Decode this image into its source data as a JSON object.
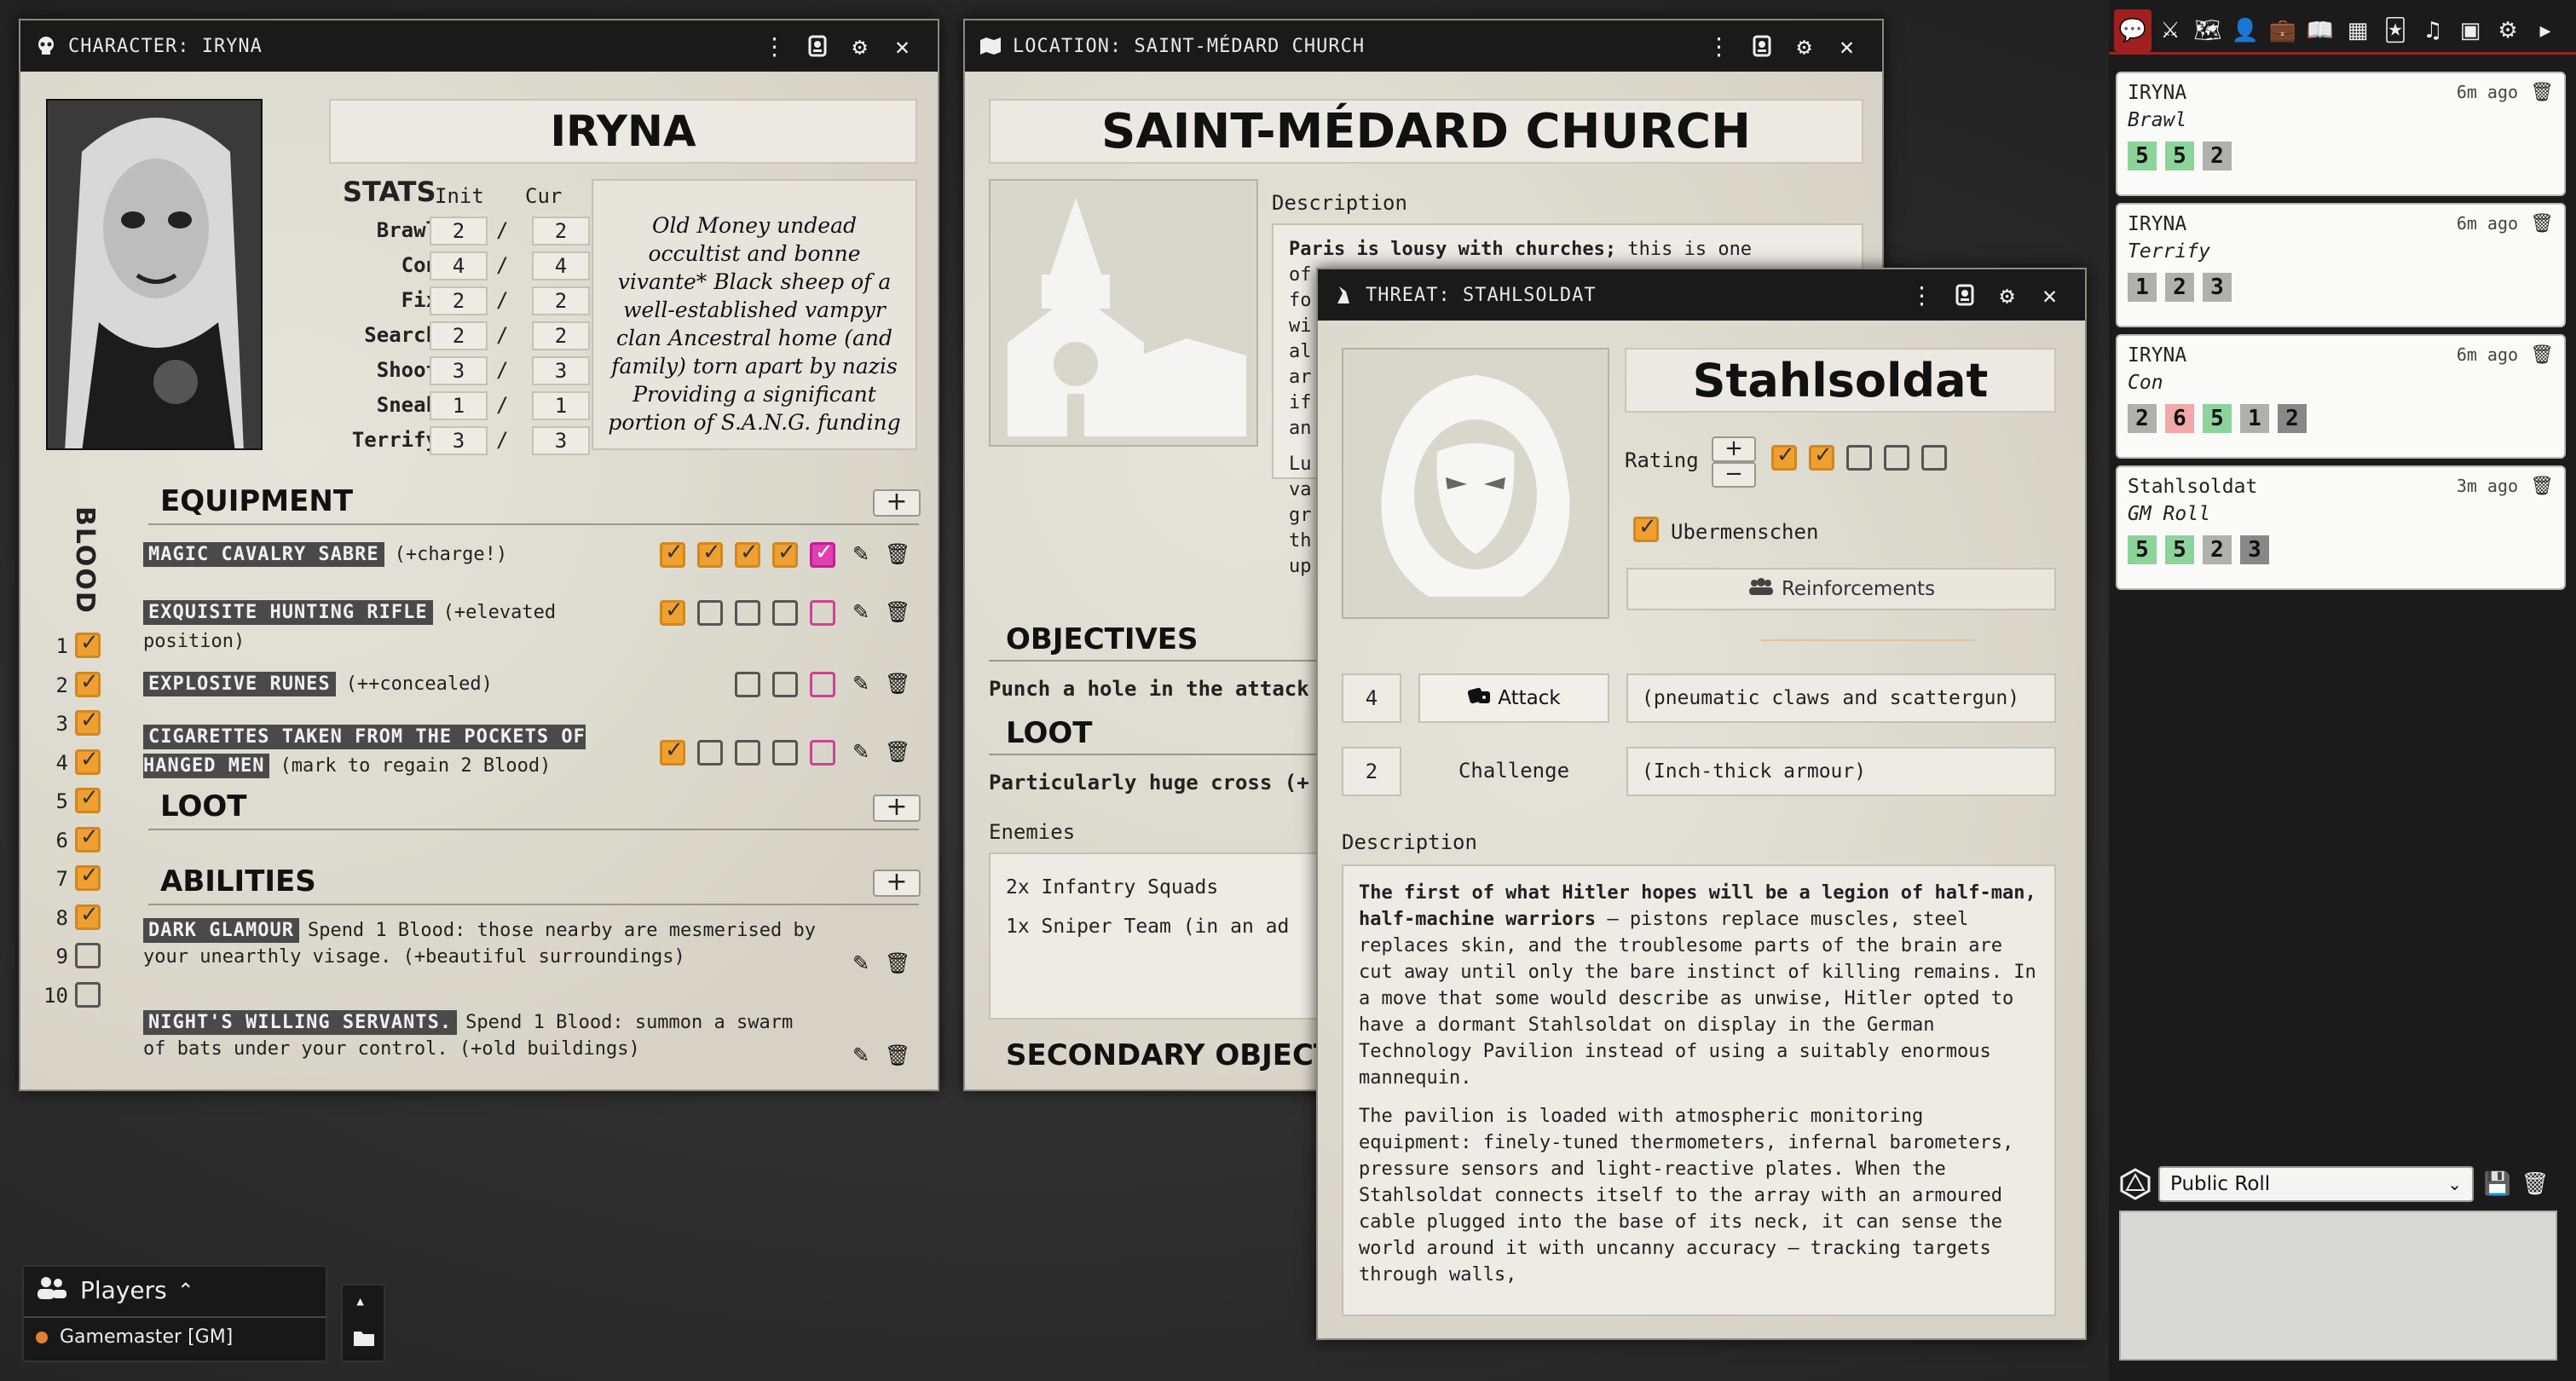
{
  "character": {
    "header": "CHARACTER: IRYNA",
    "name": "IRYNA",
    "stats_label": "STATS",
    "init_label": "Init",
    "cur_label": "Cur",
    "stats": [
      {
        "name": "Brawl",
        "init": "2",
        "cur": "2"
      },
      {
        "name": "Con",
        "init": "4",
        "cur": "4"
      },
      {
        "name": "Fix",
        "init": "2",
        "cur": "2"
      },
      {
        "name": "Search",
        "init": "2",
        "cur": "2"
      },
      {
        "name": "Shoot",
        "init": "3",
        "cur": "3"
      },
      {
        "name": "Sneak",
        "init": "1",
        "cur": "1"
      },
      {
        "name": "Terrify",
        "init": "3",
        "cur": "3"
      }
    ],
    "slash": "/",
    "bio": "Old Money undead occultist and bonne vivante* Black sheep of a well-established vampyr clan Ancestral home (and family) torn apart by nazis Providing a significant portion of S.A.N.G. funding",
    "blood_label": "BLOOD",
    "blood": [
      "1",
      "2",
      "3",
      "4",
      "5",
      "6",
      "7",
      "8",
      "9",
      "10"
    ],
    "blood_checked": 8,
    "equipment_label": "EQUIPMENT",
    "equipment": [
      {
        "name": "MAGIC CAVALRY SABRE",
        "note": "(+charge!)"
      },
      {
        "name": "EXQUISITE HUNTING RIFLE",
        "note": "(+elevated position)"
      },
      {
        "name": "EXPLOSIVE RUNES",
        "note": "(++concealed)"
      },
      {
        "name": "CIGARETTES TAKEN FROM THE POCKETS OF HANGED MEN",
        "note": "(mark to regain 2 Blood)"
      }
    ],
    "loot_label": "LOOT",
    "abilities_label": "ABILITIES",
    "abilities": [
      {
        "name": "DARK GLAMOUR",
        "text": "Spend 1 Blood: those nearby are mesmerised by your unearthly visage. (+beautiful surroundings)"
      },
      {
        "name": "NIGHT'S WILLING SERVANTS.",
        "text": "Spend 1 Blood: summon a swarm of bats under your control. (+old buildings)"
      }
    ]
  },
  "location": {
    "header": "LOCATION: SAINT-MÉDARD CHURCH",
    "name": "SAINT-MÉDARD CHURCH",
    "description_label": "Description",
    "desc_bold": "Paris is lousy with churches;",
    "desc_rest": "this is one",
    "desc_frag": [
      "of",
      "fo",
      "wi",
      "al",
      "ar",
      "if",
      "an"
    ],
    "desc_frag2": [
      "Lu",
      "va",
      "gr",
      "th",
      "up"
    ],
    "objectives_label": "OBJECTIVES",
    "objective": "Punch a hole in the attack",
    "loot_label": "LOOT",
    "loot": "Particularly huge cross (+",
    "enemies_label": "Enemies",
    "enemies": [
      "2x Infantry Squads",
      "1x Sniper Team (in an ad"
    ],
    "secondary_label": "SECONDARY OBJECT"
  },
  "threat": {
    "header": "THREAT: STAHLSOLDAT",
    "name": "Stahlsoldat",
    "rating_label": "Rating",
    "rating_plus": "+",
    "rating_minus": "−",
    "tag": "Ubermenschen",
    "reinforcements": "Reinforcements",
    "attack_value": "4",
    "attack_label": "Attack",
    "attack_desc": "(pneumatic claws and scattergun)",
    "challenge_value": "2",
    "challenge_label": "Challenge",
    "challenge_desc": "(Inch-thick armour)",
    "description_label": "Description",
    "desc_bold": "The first of what Hitler hopes will be a legion of half-man, half-machine warriors",
    "desc_p1": " – pistons replace muscles, steel replaces skin, and the troublesome parts of the brain are cut away until only the bare instinct of killing remains. In a move that some would describe as unwise, Hitler opted to have a dormant Stahlsoldat on display in the German Technology Pavilion instead of using a suitably enormous mannequin.",
    "desc_p2": "The pavilion is loaded with atmospheric monitoring equipment: finely-tuned thermometers, infernal barometers, pressure sensors and light-reactive plates. When the Stahlsoldat connects itself to the array with an armoured cable plugged into the base of its neck, it can sense the world around it with uncanny accuracy – tracking targets through walls,"
  },
  "chat": {
    "rolls": [
      {
        "who": "IRYNA",
        "when": "6m ago",
        "stat": "Brawl",
        "dice": [
          {
            "v": "5",
            "k": "succ"
          },
          {
            "v": "5",
            "k": "succ"
          },
          {
            "v": "2",
            "k": "grey"
          }
        ]
      },
      {
        "who": "IRYNA",
        "when": "6m ago",
        "stat": "Terrify",
        "dice": [
          {
            "v": "1",
            "k": "grey"
          },
          {
            "v": "2",
            "k": "grey"
          },
          {
            "v": "3",
            "k": "grey"
          }
        ]
      },
      {
        "who": "IRYNA",
        "when": "6m ago",
        "stat": "Con",
        "dice": [
          {
            "v": "2",
            "k": "grey"
          },
          {
            "v": "6",
            "k": "fail"
          },
          {
            "v": "5",
            "k": "succ"
          },
          {
            "v": "1",
            "k": "grey"
          },
          {
            "v": "2",
            "k": "dark"
          }
        ]
      },
      {
        "who": "Stahlsoldat",
        "when": "3m ago",
        "stat": "GM Roll",
        "dice": [
          {
            "v": "5",
            "k": "succ"
          },
          {
            "v": "5",
            "k": "succ"
          },
          {
            "v": "2",
            "k": "grey"
          },
          {
            "v": "3",
            "k": "dark"
          }
        ]
      }
    ],
    "roll_mode": "Public Roll"
  },
  "players": {
    "title": "Players",
    "list": [
      {
        "name": "Gamemaster [GM]",
        "color": "#e08030"
      }
    ]
  },
  "colors": {
    "accent": "#f0a030",
    "pink": "#e040b0",
    "header": "#1a1a1a",
    "sidebar_active": "#a02020"
  }
}
